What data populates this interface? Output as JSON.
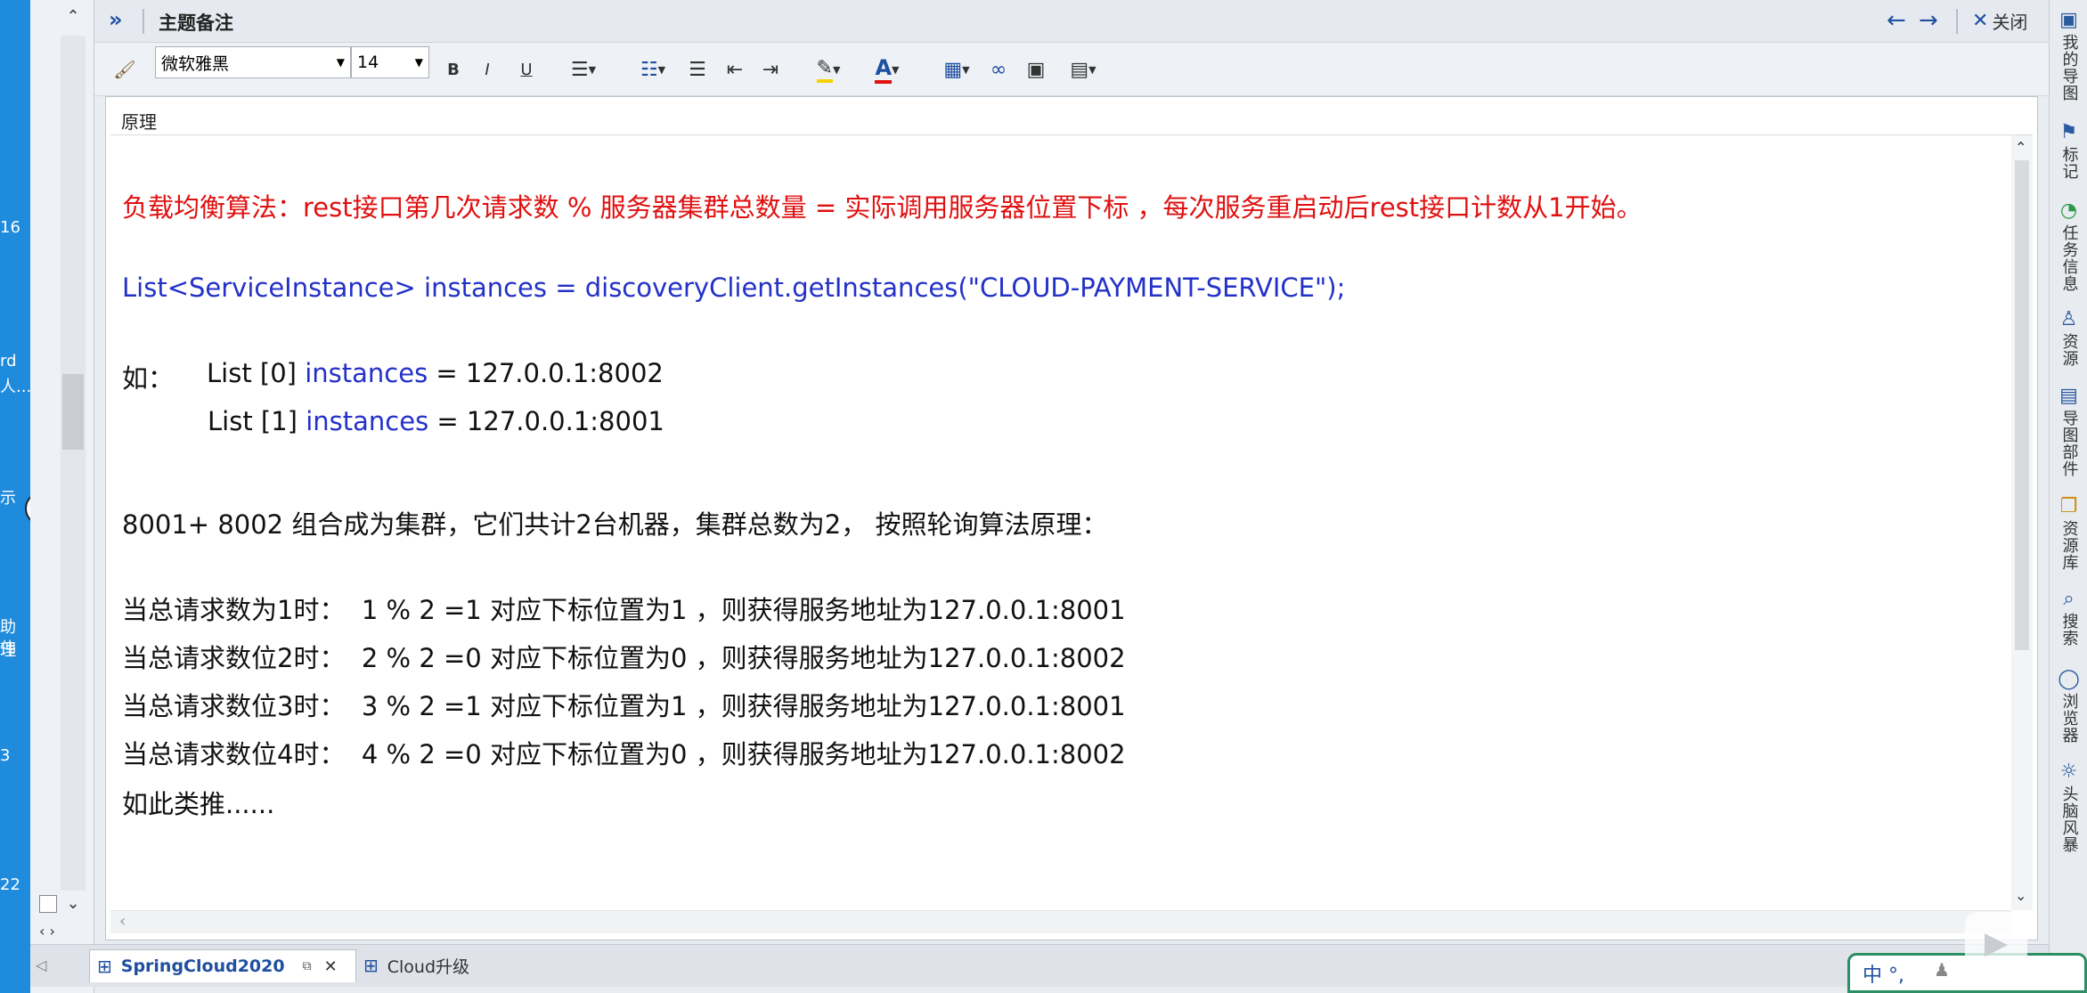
{
  "panel": {
    "title": "主题备注",
    "close_label": "关闭",
    "field_title": "原理"
  },
  "toolbar": {
    "font_name": "微软雅黑",
    "font_size": "14",
    "bold": "B",
    "italic": "I",
    "underline": "U"
  },
  "content": {
    "line1": "负载均衡算法：rest接口第几次请求数 % 服务器集群总数量 = 实际调用服务器位置下标 ，每次服务重启动后rest接口计数从1开始。",
    "line2_a": "List<ServiceInstance> instances = ",
    "line2_b": "discoveryClient.getInstances(\"CLOUD-PAYMENT-SERVICE\");",
    "line3_prefix": "如：",
    "line3_a": "List [0] ",
    "line3_b": "instances",
    "line3_c": " = 127.0.0.1:8002",
    "line4_a": "List [1] ",
    "line4_b": "instances",
    "line4_c": " = 127.0.0.1:8001",
    "line5": "8001+ 8002 组合成为集群，它们共计2台机器，集群总数为2， 按照轮询算法原理：",
    "line6": "当总请求数为1时：  1 % 2 =1 对应下标位置为1 ，则获得服务地址为127.0.0.1:8001",
    "line7": "当总请求数位2时：  2 % 2 =0 对应下标位置为0 ，则获得服务地址为127.0.0.1:8002",
    "line8": "当总请求数位3时：  3 % 2 =1 对应下标位置为1 ，则获得服务地址为127.0.0.1:8001",
    "line9": "当总请求数位4时：  4 % 2 =0 对应下标位置为0 ，则获得服务地址为127.0.0.1:8002",
    "line10": "如此类推......"
  },
  "sidebar": {
    "items": [
      "我的导图",
      "标记",
      "任务信息",
      "资源",
      "导图部件",
      "资源库",
      "搜索",
      "浏览器",
      "头脑风暴"
    ]
  },
  "tabs": {
    "active": "SpringCloud2020",
    "other": "Cloud升级"
  },
  "desktop": {
    "labels": [
      "16",
      "rd",
      "人...",
      "示",
      "助理",
      "伟",
      "3",
      "22"
    ]
  },
  "ime": {
    "label": "中 °,"
  },
  "colors": {
    "red_text": "#e01010",
    "blue_text": "#2331c8",
    "accent": "#2b5fb4"
  }
}
